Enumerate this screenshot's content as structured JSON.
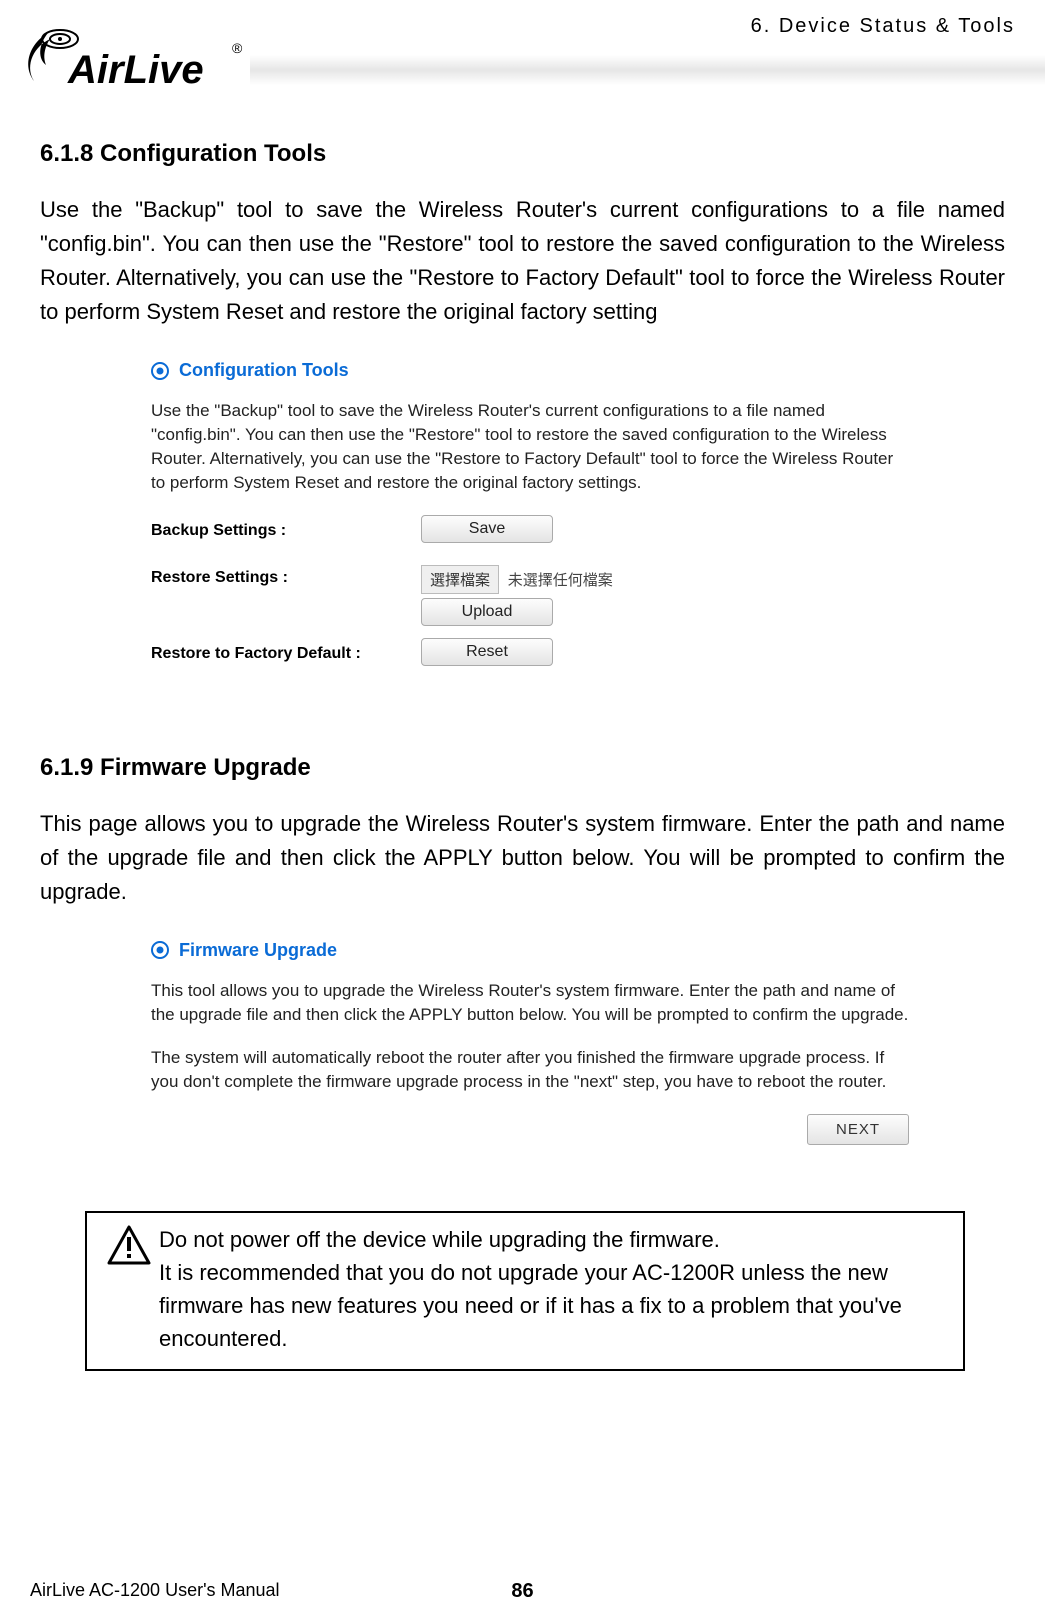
{
  "header": {
    "chapter": "6. Device Status & Tools",
    "brand": "AirLive"
  },
  "s1": {
    "heading": "6.1.8 Configuration Tools",
    "body": "Use the \"Backup\" tool to save the Wireless Router's current configurations to a file named \"config.bin\". You can then use the \"Restore\" tool to restore the saved configuration to the Wireless Router. Alternatively, you can use the \"Restore to Factory Default\" tool to force the Wireless Router to perform System Reset and restore the original factory setting",
    "panel": {
      "title": "Configuration Tools",
      "desc": "Use the \"Backup\" tool to save the Wireless Router's current configurations to a file named \"config.bin\". You can then use the \"Restore\" tool to restore the saved configuration to the Wireless Router. Alternatively, you can use the \"Restore to Factory Default\" tool to force the Wireless Router to perform System Reset and restore the original factory settings.",
      "rows": {
        "backup_label": "Backup Settings :",
        "save_btn": "Save",
        "restore_label": "Restore Settings :",
        "choose_btn": "選擇檔案",
        "no_file": "未選擇任何檔案",
        "upload_btn": "Upload",
        "factory_label": "Restore to Factory Default :",
        "reset_btn": "Reset"
      }
    }
  },
  "s2": {
    "heading": "6.1.9 Firmware Upgrade",
    "body": "This page allows you to upgrade the Wireless Router's system firmware. Enter the path and name of the upgrade file and then click the APPLY button below. You will be prompted to confirm the upgrade.",
    "panel": {
      "title": "Firmware Upgrade",
      "desc1": "This tool allows you to upgrade the Wireless Router's system firmware. Enter the path and name of the upgrade file and then click the APPLY button below. You will be prompted to confirm the upgrade.",
      "desc2": "The system will automatically reboot the router after you finished the firmware upgrade process. If you don't complete the firmware upgrade process in the \"next\" step, you have to reboot the router.",
      "next_btn": "NEXT"
    }
  },
  "warning": {
    "line1": "Do not power off the device while upgrading the firmware.",
    "line2": "It is recommended that you do not upgrade your AC-1200R unless the new firmware has new features you need or if it has a fix to a problem that you've encountered."
  },
  "footer": {
    "manual": "AirLive AC-1200 User's Manual",
    "page": "86"
  }
}
